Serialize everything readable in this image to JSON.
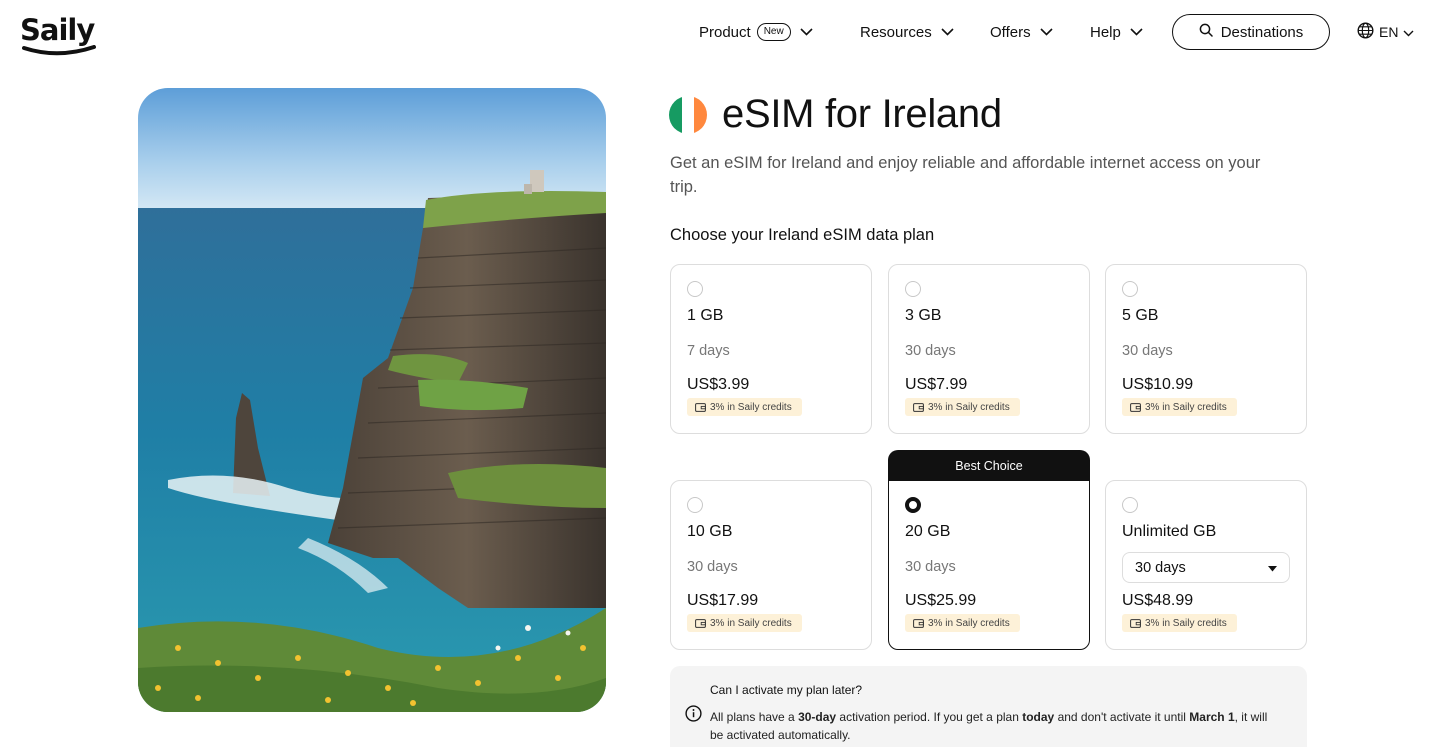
{
  "header": {
    "logo": "Saily",
    "nav": [
      {
        "label": "Product",
        "badge": "New"
      },
      {
        "label": "Resources"
      },
      {
        "label": "Offers"
      },
      {
        "label": "Help"
      }
    ],
    "destinations_label": "Destinations",
    "language": "EN"
  },
  "page": {
    "title": "eSIM for Ireland",
    "subtitle": "Get an eSIM for Ireland and enjoy reliable and affordable internet access on your trip.",
    "choose_label": "Choose your Ireland eSIM data plan",
    "flag_colors": [
      "#169b62",
      "#ffffff",
      "#ff883e"
    ]
  },
  "plans": [
    {
      "size": "1 GB",
      "days": "7 days",
      "price": "US$3.99",
      "credits": "3% in Saily credits",
      "selected": false
    },
    {
      "size": "3 GB",
      "days": "30 days",
      "price": "US$7.99",
      "credits": "3% in Saily credits",
      "selected": false
    },
    {
      "size": "5 GB",
      "days": "30 days",
      "price": "US$10.99",
      "credits": "3% in Saily credits",
      "selected": false
    },
    {
      "size": "10 GB",
      "days": "30 days",
      "price": "US$17.99",
      "credits": "3% in Saily credits",
      "selected": false
    },
    {
      "size": "20 GB",
      "days": "30 days",
      "price": "US$25.99",
      "credits": "3% in Saily credits",
      "selected": true,
      "badge": "Best Choice"
    },
    {
      "size": "Unlimited GB",
      "days": "30 days",
      "price": "US$48.99",
      "credits": "3% in Saily credits",
      "selected": false,
      "days_is_select": true
    }
  ],
  "faq": {
    "question": "Can I activate my plan later?",
    "answer_parts": [
      "All plans have a ",
      "30-day",
      " activation period. If you get a plan ",
      "today",
      " and don't activate it until ",
      "March 1",
      ", it will be activated automatically."
    ]
  },
  "icons": {
    "chevron": "chevron-down-icon",
    "search": "search-icon",
    "globe": "globe-icon",
    "info": "info-icon",
    "wallet": "wallet-icon",
    "caret": "caret-down-icon"
  }
}
